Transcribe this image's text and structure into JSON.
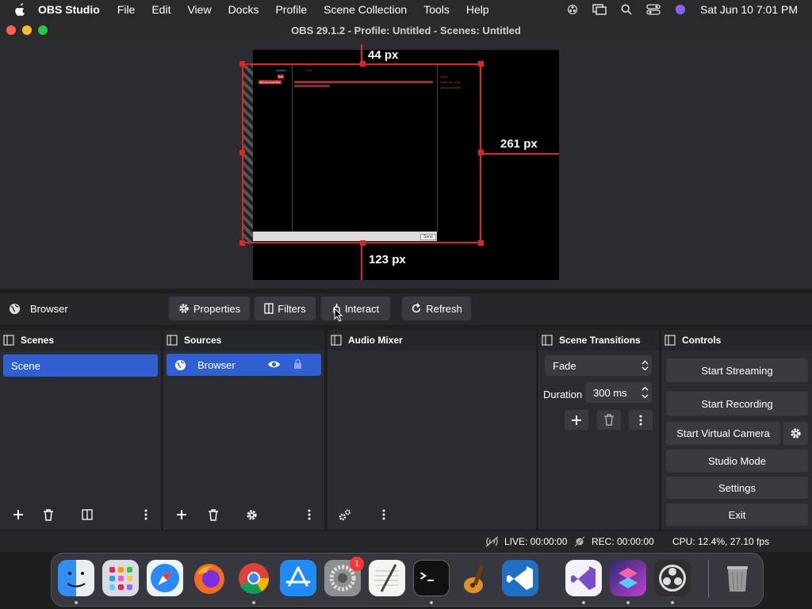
{
  "menubar": {
    "app_name": "OBS Studio",
    "items": [
      "File",
      "Edit",
      "View",
      "Docks",
      "Profile",
      "Scene Collection",
      "Tools",
      "Help"
    ],
    "clock": "Sat Jun 10  7:01 PM"
  },
  "window": {
    "title": "OBS 29.1.2 - Profile: Untitled - Scenes: Untitled"
  },
  "preview": {
    "measure_top": "44 px",
    "measure_right": "261 px",
    "measure_bottom": "123 px",
    "embed": {
      "blue_label": "System",
      "tag1": "Bot",
      "tag2": "@StreamerBot",
      "header": "Chat",
      "side_title": "Users",
      "side_l1": "Listen for chat",
      "side_l2": "@StreamerBot",
      "send": "Send"
    }
  },
  "toolbar": {
    "source_name": "Browser",
    "properties": "Properties",
    "filters": "Filters",
    "interact": "Interact",
    "refresh": "Refresh"
  },
  "scenes": {
    "title": "Scenes",
    "items": [
      "Scene"
    ]
  },
  "sources": {
    "title": "Sources",
    "items": [
      "Browser"
    ]
  },
  "mixer": {
    "title": "Audio Mixer"
  },
  "transitions": {
    "title": "Scene Transitions",
    "type": "Fade",
    "duration_label": "Duration",
    "duration_value": "300 ms"
  },
  "controls": {
    "title": "Controls",
    "start_streaming": "Start Streaming",
    "start_recording": "Start Recording",
    "start_virtual_camera": "Start Virtual Camera",
    "studio_mode": "Studio Mode",
    "settings": "Settings",
    "exit": "Exit"
  },
  "status": {
    "live": "LIVE: 00:00:00",
    "rec": "REC: 00:00:00",
    "cpu": "CPU: 12.4%, 27.10 fps"
  },
  "dock": {
    "settings_badge": "1"
  },
  "colors": {
    "accent": "#2f5fd0",
    "selection_red": "#e02424"
  }
}
